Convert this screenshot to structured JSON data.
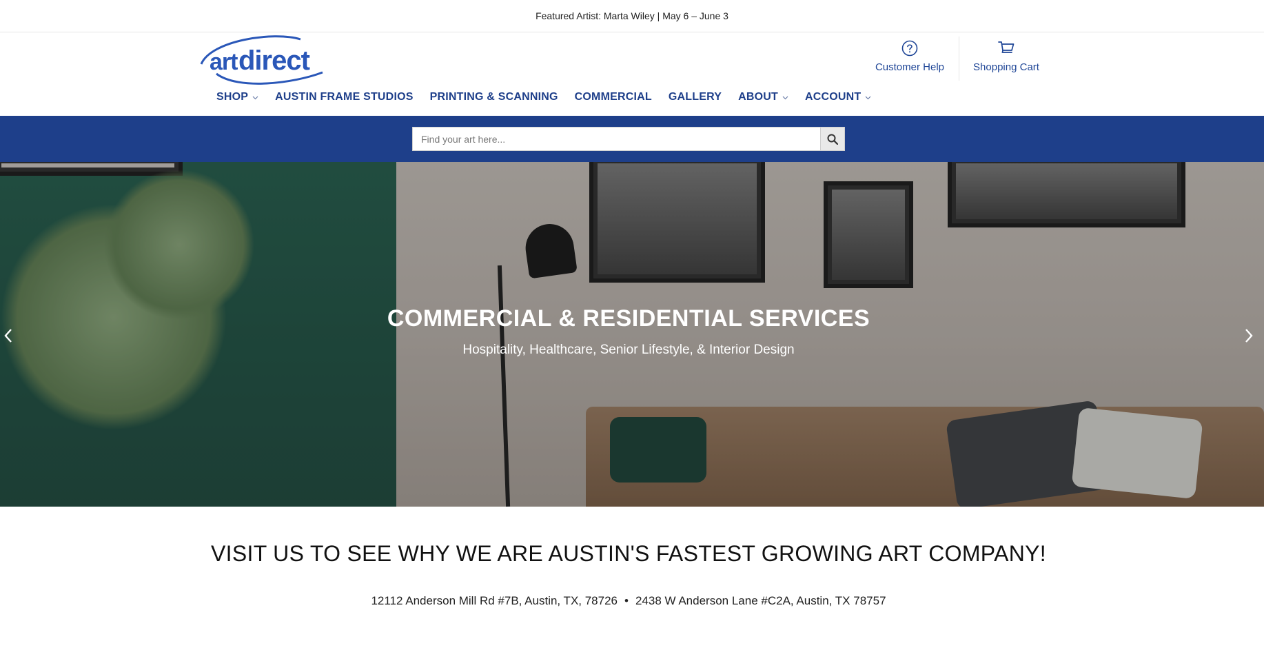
{
  "announcement": "Featured Artist: Marta Wiley | May 6 – June 3",
  "logo": {
    "text_art": "art",
    "text_direct": "direct",
    "brand_color": "#2a57b8"
  },
  "utility": {
    "help_label": "Customer Help",
    "cart_label": "Shopping Cart",
    "help_icon": "question-circle-icon",
    "cart_icon": "shopping-cart-icon"
  },
  "nav": {
    "items": [
      {
        "label": "SHOP",
        "dropdown": true
      },
      {
        "label": "AUSTIN FRAME STUDIOS",
        "dropdown": false
      },
      {
        "label": "PRINTING & SCANNING",
        "dropdown": false
      },
      {
        "label": "COMMERCIAL",
        "dropdown": false
      },
      {
        "label": "GALLERY",
        "dropdown": false
      },
      {
        "label": "ABOUT",
        "dropdown": true
      },
      {
        "label": "ACCOUNT",
        "dropdown": true
      }
    ]
  },
  "search": {
    "placeholder": "Find your art here...",
    "value": ""
  },
  "hero": {
    "title": "COMMERCIAL & RESIDENTIAL SERVICES",
    "subtitle": "Hospitality, Healthcare, Senior Lifestyle, & Interior Design"
  },
  "visit": {
    "heading": "VISIT US TO SEE WHY WE ARE AUSTIN'S FASTEST GROWING ART COMPANY!",
    "address_1": "12112 Anderson Mill Rd #7B, Austin, TX, 78726",
    "separator": "•",
    "address_2": "2438 W Anderson Lane #C2A, Austin, TX 78757"
  },
  "colors": {
    "navy": "#1e3f8a",
    "accent_blue": "#1e4596"
  }
}
